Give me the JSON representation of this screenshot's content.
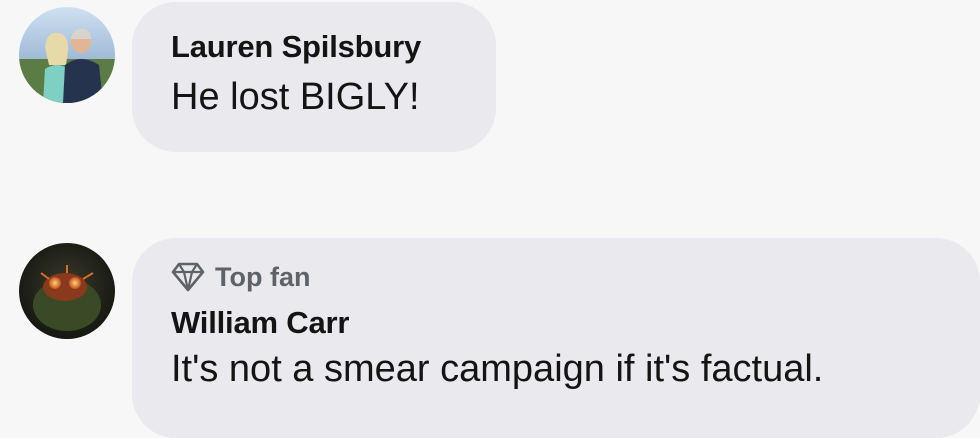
{
  "comments": [
    {
      "author": "Lauren Spilsbury",
      "text": "He lost BIGLY!"
    },
    {
      "badge_label": "Top fan",
      "badge_icon": "diamond-icon",
      "author": "William Carr",
      "text": "It's not a smear campaign if it's factual."
    }
  ],
  "colors": {
    "page_background": "#f7f7f8",
    "bubble_background": "#e9e9ee",
    "text": "#141414",
    "badge_text": "#5f6368"
  }
}
